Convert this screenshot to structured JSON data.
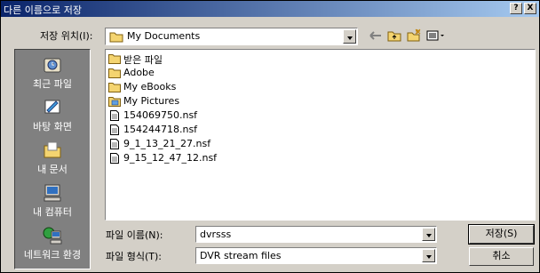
{
  "window": {
    "title": "다른 이름으로 저장",
    "help_label": "?",
    "close_label": "X"
  },
  "lookin": {
    "label": "저장 위치(I):",
    "value": "My Documents",
    "folder_icon": "folder-icon"
  },
  "toolbar": {
    "icons": [
      "back-arrow-icon",
      "up-folder-icon",
      "new-folder-icon",
      "view-menu-icon"
    ]
  },
  "places": [
    {
      "label": "최근 파일",
      "icon": "recent-files-icon"
    },
    {
      "label": "바탕 화면",
      "icon": "desktop-icon"
    },
    {
      "label": "내 문서",
      "icon": "my-documents-icon"
    },
    {
      "label": "내 컴퓨터",
      "icon": "my-computer-icon"
    },
    {
      "label": "네트워크 환경",
      "icon": "network-icon"
    }
  ],
  "files": [
    {
      "name": "받은 파일",
      "kind": "folder"
    },
    {
      "name": "Adobe",
      "kind": "folder"
    },
    {
      "name": "My eBooks",
      "kind": "folder"
    },
    {
      "name": "My Pictures",
      "kind": "picture-folder"
    },
    {
      "name": "154069750.nsf",
      "kind": "file"
    },
    {
      "name": "154244718.nsf",
      "kind": "file"
    },
    {
      "name": "9_1_13_21_27.nsf",
      "kind": "file"
    },
    {
      "name": "9_15_12_47_12.nsf",
      "kind": "file"
    }
  ],
  "filename": {
    "label": "파일 이름(N):",
    "value": "dvrsss"
  },
  "filetype": {
    "label": "파일 형식(T):",
    "value": "DVR stream files"
  },
  "buttons": {
    "save_label": "저장(S)",
    "cancel_label": "취소"
  }
}
